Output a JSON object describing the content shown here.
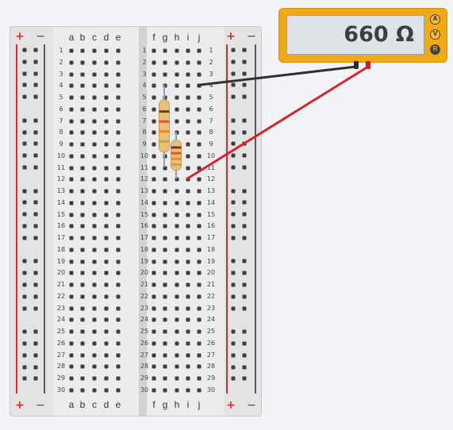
{
  "breadboard": {
    "column_letters_left": [
      "a",
      "b",
      "c",
      "d",
      "e"
    ],
    "column_letters_right": [
      "f",
      "g",
      "h",
      "i",
      "j"
    ],
    "row_count": 30,
    "rail_signs": {
      "plus": "+",
      "minus": "−"
    },
    "colors": {
      "rail_positive": "#d92b2b",
      "rail_negative": "#505864",
      "hole": "#3e3e3e"
    }
  },
  "components": {
    "resistors": [
      {
        "name": "resistor-1",
        "column": "g",
        "from_row": 4,
        "to_row": 11,
        "band_colors": [
          "#7a3a1d",
          "#e9541b",
          "#ef8a1e",
          "#c9a14a"
        ]
      },
      {
        "name": "resistor-2",
        "column": "h",
        "from_row": 8,
        "to_row": 12,
        "band_colors": [
          "#7a3a1d",
          "#e9541b",
          "#ef8a1e",
          "#c9a14a"
        ]
      }
    ],
    "wires": [
      {
        "name": "black-probe-wire",
        "color": "#2f2f2f",
        "from_row": 4,
        "to": "com"
      },
      {
        "name": "red-probe-wire",
        "color": "#d0282a",
        "from_row": 12,
        "to": "ohm"
      }
    ]
  },
  "multimeter": {
    "reading": "660 Ω",
    "modes": [
      {
        "label": "A",
        "active": false
      },
      {
        "label": "V",
        "active": false
      },
      {
        "label": "R",
        "active": true
      }
    ],
    "colors": {
      "body": "#f2a916",
      "com_probe": "#2f2f2f",
      "positive_probe": "#c8191e"
    }
  }
}
